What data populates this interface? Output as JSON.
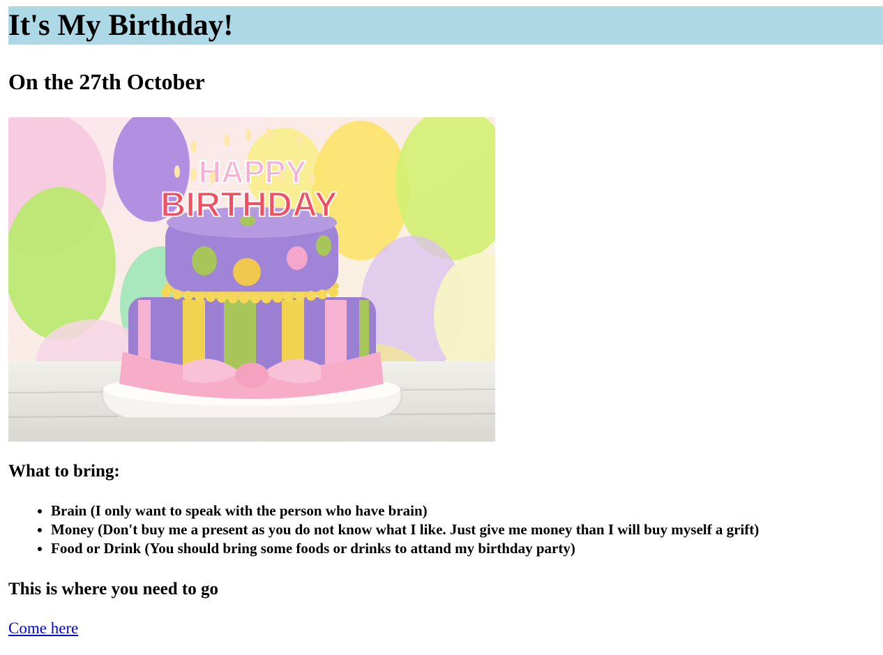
{
  "page": {
    "title": "It's My Birthday!",
    "subtitle": "On the 27th October",
    "hero_image": {
      "icon": "birthday-cake-image",
      "cake_text_top": "HAPPY",
      "cake_text_bottom": "BIRTHDAY"
    },
    "bring_heading": "What to bring:",
    "bring_items": [
      "Brain (I only want to speak with the person who have brain)",
      "Money (Don't buy me a present as you do not know what I like. Just give me money than I will buy myself a grift)",
      "Food or Drink (You should bring some foods or drinks to attand my birthday party)"
    ],
    "go_heading": "This is where you need to go",
    "link_text": "Come here"
  },
  "colors": {
    "title_bg": "#add8e6",
    "link": "#0000ee",
    "cake_purple": "#9b7fd3",
    "cake_pink": "#f6b4d2",
    "cake_yellow": "#f2d34f",
    "cake_green": "#a8c55a"
  }
}
